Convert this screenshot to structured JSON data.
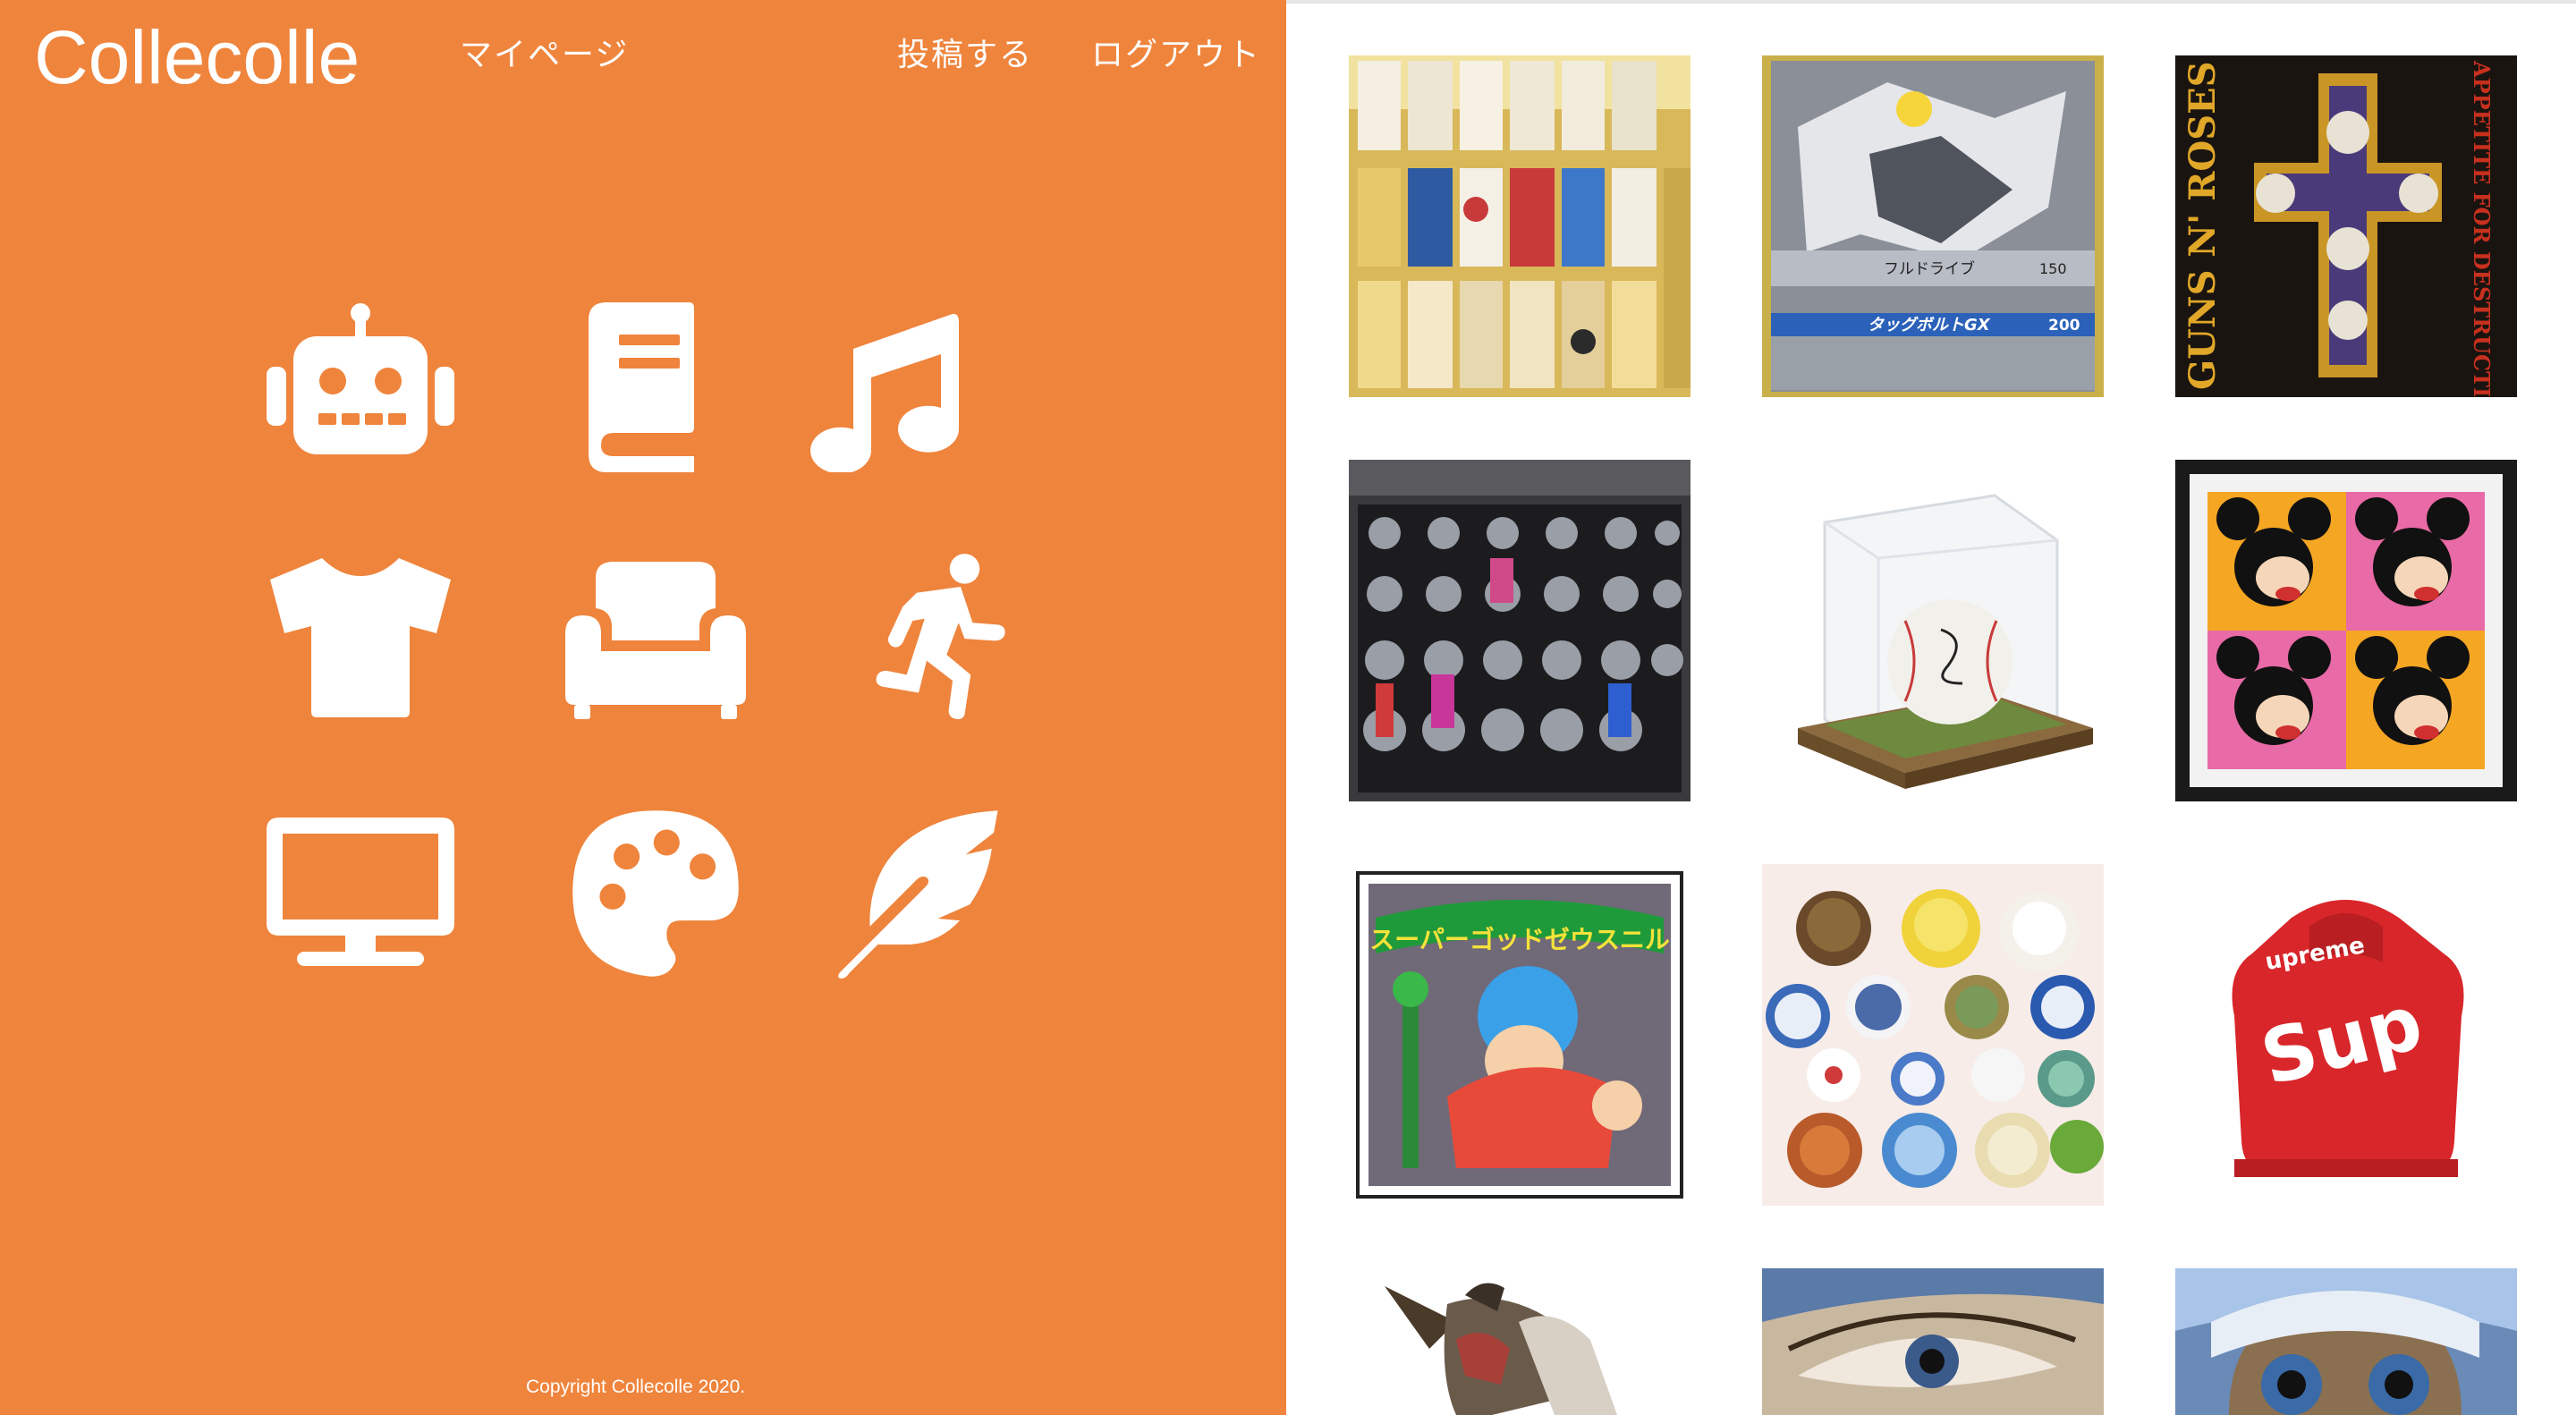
{
  "header": {
    "logo": "Collecolle",
    "nav": {
      "mypage": "マイページ",
      "post": "投稿する",
      "logout": "ログアウト"
    }
  },
  "categories": [
    {
      "icon": "robot-icon"
    },
    {
      "icon": "book-icon"
    },
    {
      "icon": "music-note-icon"
    },
    {
      "icon": "tshirt-icon"
    },
    {
      "icon": "couch-icon"
    },
    {
      "icon": "running-person-icon"
    },
    {
      "icon": "monitor-icon"
    },
    {
      "icon": "palette-icon"
    },
    {
      "icon": "feather-icon"
    }
  ],
  "footer": {
    "copyright": "Copyright Collecolle 2020."
  },
  "colors": {
    "brand_orange": "#ef843c",
    "white": "#ffffff"
  },
  "posts": [
    {
      "subject": "sake-cup-collection"
    },
    {
      "subject": "pokemon-card",
      "card": {
        "ability_name": "フルドライブ",
        "hp_value": "150",
        "gx_move_name": "タッグボルトGX",
        "gx_damage": "200"
      }
    },
    {
      "subject": "album-cover",
      "album": {
        "band": "GUNS N' ROSES",
        "title": "APPETITE FOR DESTRUCTION"
      }
    },
    {
      "subject": "watch-collection-case"
    },
    {
      "subject": "signed-baseball-case"
    },
    {
      "subject": "mickey-pop-art-print"
    },
    {
      "subject": "bikkuriman-sticker",
      "sticker_title": "スーパーゴッドゼウスニル"
    },
    {
      "subject": "ceramic-plates"
    },
    {
      "subject": "red-hoodie",
      "hoodie_text": "Sup"
    },
    {
      "subject": "warrior-figure"
    },
    {
      "subject": "illustration-eye"
    },
    {
      "subject": "et-figure"
    }
  ]
}
